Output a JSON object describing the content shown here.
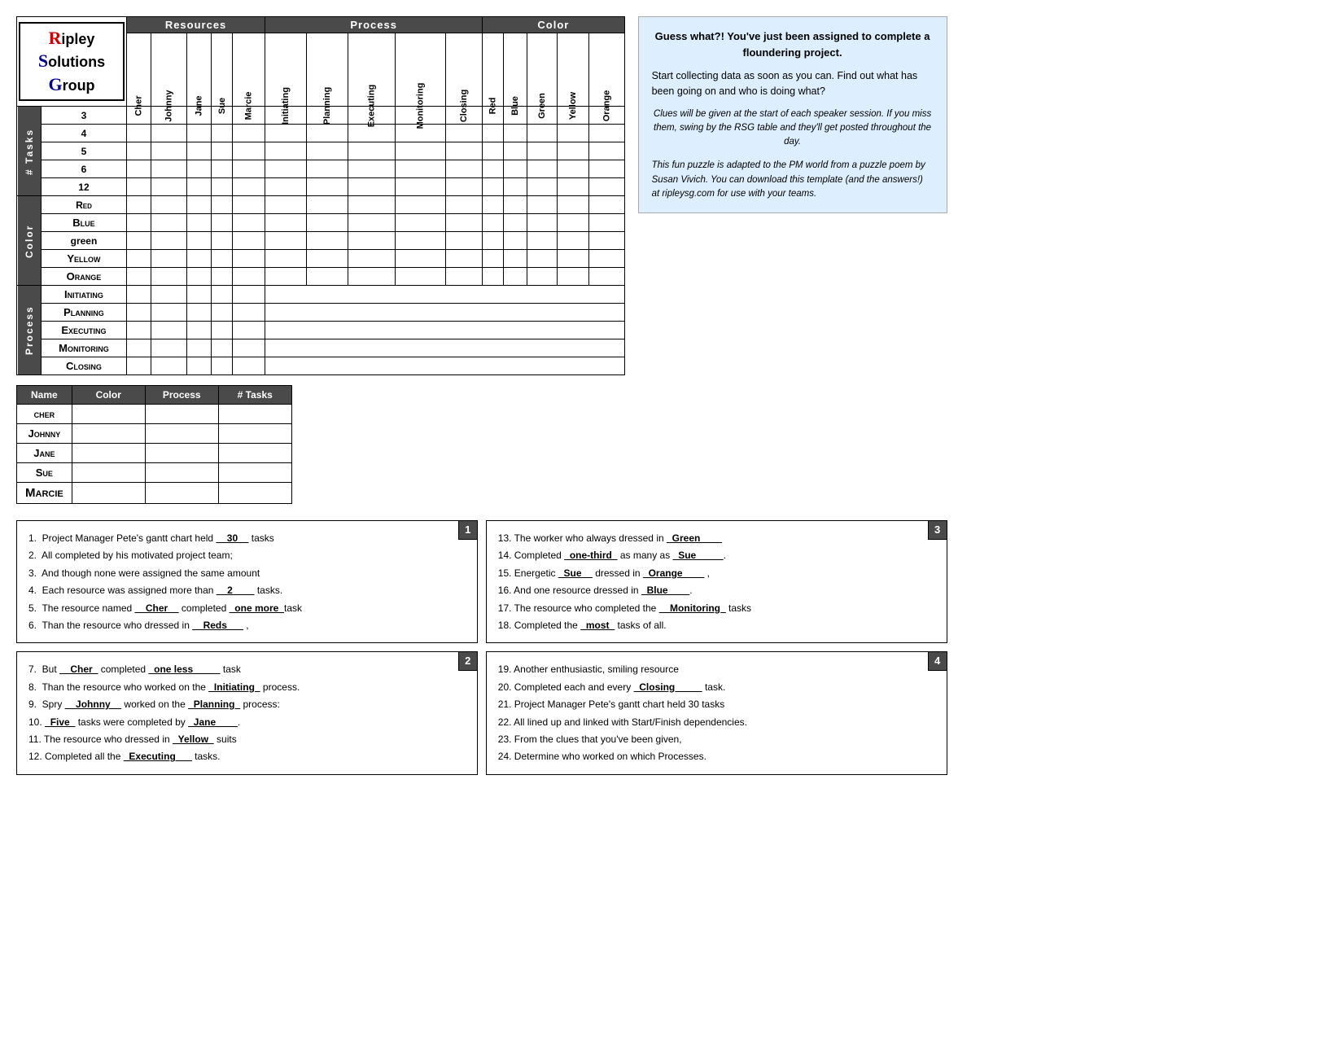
{
  "logo": {
    "line1": "ipley",
    "line2": "olutions",
    "line3": "roup"
  },
  "headers": {
    "resources": "Resources",
    "process": "Process",
    "color": "Color"
  },
  "resource_cols": [
    "Cher",
    "Johnny",
    "Jane",
    "Sue",
    "Marcie"
  ],
  "process_cols": [
    "Initiating",
    "Planning",
    "Executing",
    "Monitoring",
    "Closing"
  ],
  "color_cols": [
    "Red",
    "Blue",
    "Green",
    "Yellow",
    "Orange"
  ],
  "side_labels": {
    "tasks": "# Tasks",
    "color": "Color",
    "process": "Process"
  },
  "task_rows": [
    "3",
    "4",
    "5",
    "6",
    "12"
  ],
  "color_rows": [
    "Red",
    "Blue",
    "Green",
    "Yellow",
    "Orange"
  ],
  "process_rows": [
    "Initiating",
    "Planning",
    "Executing",
    "Monitoring",
    "Closing"
  ],
  "summary_table": {
    "headers": [
      "Name",
      "Color",
      "Process",
      "# Tasks"
    ],
    "rows": [
      {
        "name": "Cher"
      },
      {
        "name": "Johnny"
      },
      {
        "name": "Jane"
      },
      {
        "name": "Sue"
      },
      {
        "name": "Marcie"
      }
    ]
  },
  "info_box": {
    "title": "Guess what?! You've just been assigned to complete a floundering project.",
    "body": "Start collecting data as soon as you can.  Find out what has been going on and who is doing what?",
    "italic": "Clues will be given at the start of each speaker session.  If you miss them, swing by the RSG table and they'll get posted throughout the day.",
    "footer": "This fun puzzle is adapted to the PM world from a puzzle poem by Susan Vivich.  You can download this template (and the answers!) at ripleysg.com for use with your teams."
  },
  "clue_boxes": [
    {
      "number": "1",
      "lines": [
        "1.  Project Manager Pete’s gantt chart held __30__ tasks",
        "2.  All completed by his motivated project team;",
        "3.  And though none were assigned the same amount",
        "4.  Each resource was assigned more than __2____ tasks.",
        "5.  The resource named __Cher__ completed _one more_task",
        "6.  Than the resource who dressed in __Reds___ ,"
      ]
    },
    {
      "number": "2",
      "lines": [
        "7.  But __Cher_ completed _one less_____ task",
        "8.  Than the resource who worked on the _Initiating_ process.",
        "9.  Spry __Johnny__ worked on the _Planning_ process:",
        "10. _Five_ tasks were completed by _Jane____.",
        "11. The resource who dressed in _Yellow_ suits",
        "12. Completed all the _Executing___ tasks."
      ]
    },
    {
      "number": "3",
      "lines": [
        "13. The worker who always dressed in _Green____",
        "14. Completed _one-third_ as many as _Sue_____.",
        "15. Energetic _Sue__ dressed in _Orange____ ,",
        "16. And one resource dressed in _Blue____.",
        "17. The resource who completed the __Monitoring_ tasks",
        "18. Completed the _most_ tasks of all."
      ]
    },
    {
      "number": "4",
      "lines": [
        "19. Another enthusiastic, smiling resource",
        "20. Completed each and every _Closing____ task.",
        "21. Project Manager Pete’s gantt chart held 30 tasks",
        "22. All lined up and linked with Start/Finish dependencies.",
        "23. From the clues that you’ve been given,",
        "24. Determine who worked on which Processes."
      ]
    }
  ]
}
